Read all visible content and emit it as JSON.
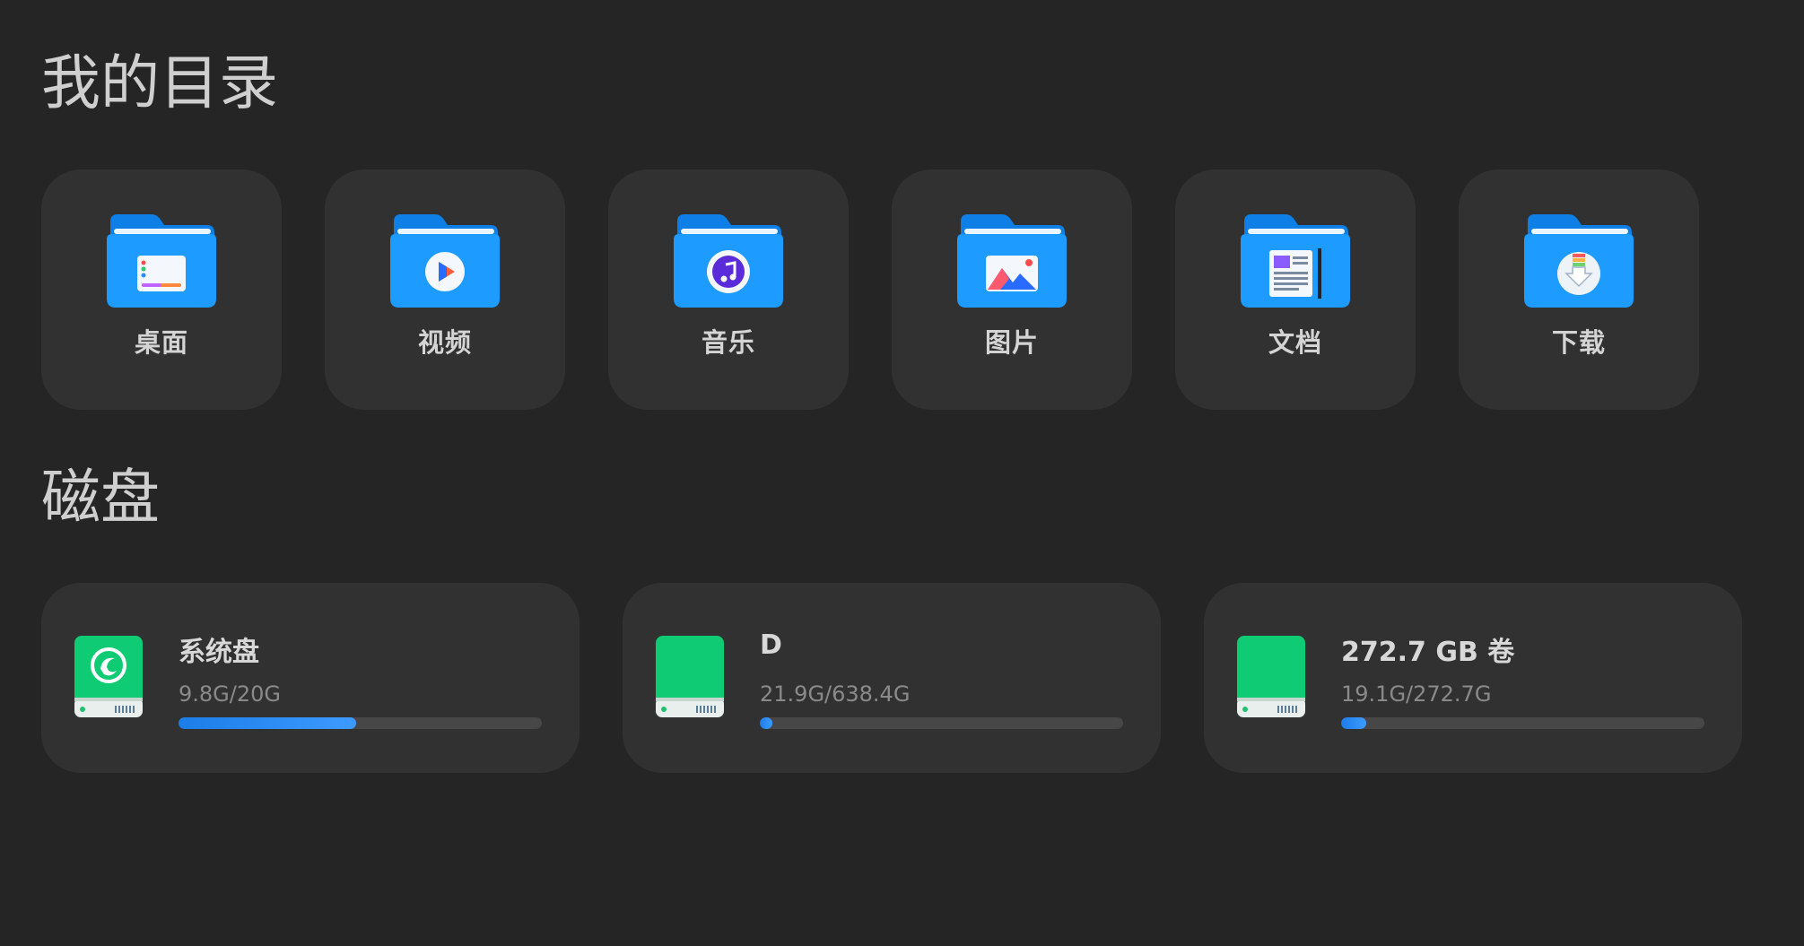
{
  "sections": {
    "directories_title": "我的目录",
    "disks_title": "磁盘"
  },
  "directories": [
    {
      "label": "桌面",
      "icon": "desktop-folder-icon"
    },
    {
      "label": "视频",
      "icon": "video-folder-icon"
    },
    {
      "label": "音乐",
      "icon": "music-folder-icon"
    },
    {
      "label": "图片",
      "icon": "pictures-folder-icon"
    },
    {
      "label": "文档",
      "icon": "documents-folder-icon"
    },
    {
      "label": "下载",
      "icon": "downloads-folder-icon"
    }
  ],
  "disks": [
    {
      "name": "系统盘",
      "usage": "9.8G/20G",
      "fraction": 0.49,
      "icon": "system-disk-icon"
    },
    {
      "name": "D",
      "usage": "21.9G/638.4G",
      "fraction": 0.034,
      "icon": "drive-icon"
    },
    {
      "name": "272.7 GB 卷",
      "usage": "19.1G/272.7G",
      "fraction": 0.07,
      "icon": "drive-icon"
    }
  ],
  "colors": {
    "background": "#252525",
    "card": "#313131",
    "folder_blue": "#1e9bff",
    "disk_green": "#0fcb74",
    "progress_blue": "#2a8cff"
  }
}
